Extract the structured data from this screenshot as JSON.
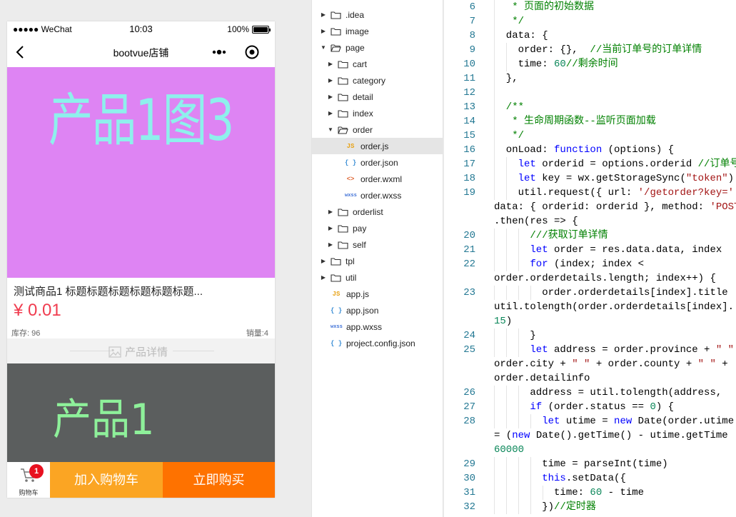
{
  "phone": {
    "status": {
      "carrier": "●●●●● WeChat",
      "time": "10:03",
      "battery": "100%",
      "battery_level": 1.0
    },
    "nav": {
      "title": "bootvue店铺"
    },
    "banner_text": "产品1图3",
    "product": {
      "title": "测试商品1 标题标题标题标题标题标题...",
      "price": "¥ 0.01",
      "stock": "库存: 96",
      "sales": "销量:4"
    },
    "detail_label": "产品详情",
    "detail_image_text": "产品1",
    "tabbar": {
      "cart_label": "购物车",
      "cart_badge": "1",
      "add_cart": "加入购物车",
      "buy_now": "立即购买"
    },
    "colors": {
      "banner": "#de84f3",
      "banner_text": "#8ef0ec",
      "detail_bg": "#5b5e5e",
      "detail_text": "#8ef09a",
      "price": "#f03c4f",
      "add_cart": "#fba523",
      "buy_now": "#fe7200",
      "badge": "#e8101f"
    }
  },
  "tree": [
    {
      "label": ".idea",
      "kind": "folder",
      "depth": 0,
      "open": false
    },
    {
      "label": "image",
      "kind": "folder",
      "depth": 0,
      "open": false
    },
    {
      "label": "page",
      "kind": "folder",
      "depth": 0,
      "open": true
    },
    {
      "label": "cart",
      "kind": "folder",
      "depth": 1,
      "open": false
    },
    {
      "label": "category",
      "kind": "folder",
      "depth": 1,
      "open": false
    },
    {
      "label": "detail",
      "kind": "folder",
      "depth": 1,
      "open": false
    },
    {
      "label": "index",
      "kind": "folder",
      "depth": 1,
      "open": false
    },
    {
      "label": "order",
      "kind": "folder",
      "depth": 1,
      "open": true
    },
    {
      "label": "order.js",
      "kind": "js",
      "depth": 2,
      "selected": true
    },
    {
      "label": "order.json",
      "kind": "json",
      "depth": 2
    },
    {
      "label": "order.wxml",
      "kind": "wxml",
      "depth": 2
    },
    {
      "label": "order.wxss",
      "kind": "wxss",
      "depth": 2
    },
    {
      "label": "orderlist",
      "kind": "folder",
      "depth": 1,
      "open": false
    },
    {
      "label": "pay",
      "kind": "folder",
      "depth": 1,
      "open": false
    },
    {
      "label": "self",
      "kind": "folder",
      "depth": 1,
      "open": false
    },
    {
      "label": "tpl",
      "kind": "folder",
      "depth": 0,
      "open": false
    },
    {
      "label": "util",
      "kind": "folder",
      "depth": 0,
      "open": false
    },
    {
      "label": "app.js",
      "kind": "js",
      "depth": 0
    },
    {
      "label": "app.json",
      "kind": "json",
      "depth": 0
    },
    {
      "label": "app.wxss",
      "kind": "wxss",
      "depth": 0
    },
    {
      "label": "project.config.json",
      "kind": "json",
      "depth": 0
    }
  ],
  "file_icons": {
    "js": "JS",
    "json": "{ }",
    "wxml": "<>",
    "wxss": "wxss"
  },
  "editor": {
    "lines": [
      {
        "no": "6",
        "indent": 1,
        "tokens": [
          [
            "c",
            "   * 页面的初始数据"
          ]
        ]
      },
      {
        "no": "7",
        "indent": 1,
        "tokens": [
          [
            "c",
            "   */"
          ]
        ]
      },
      {
        "no": "8",
        "indent": 1,
        "tokens": [
          [
            "p",
            "  data: {"
          ]
        ]
      },
      {
        "no": "9",
        "indent": 2,
        "tokens": [
          [
            "p",
            "    order: {},  "
          ],
          [
            "c",
            "//当前订单号的订单详情"
          ]
        ]
      },
      {
        "no": "10",
        "indent": 2,
        "tokens": [
          [
            "p",
            "    time: "
          ],
          [
            "n",
            "60"
          ],
          [
            "c",
            "//剩余时间"
          ]
        ]
      },
      {
        "no": "11",
        "indent": 1,
        "tokens": [
          [
            "p",
            "  },"
          ]
        ]
      },
      {
        "no": "12",
        "indent": 1,
        "tokens": [
          [
            "p",
            ""
          ]
        ]
      },
      {
        "no": "13",
        "indent": 1,
        "tokens": [
          [
            "c",
            "  /**"
          ]
        ]
      },
      {
        "no": "14",
        "indent": 1,
        "tokens": [
          [
            "c",
            "   * 生命周期函数--监听页面加载"
          ]
        ]
      },
      {
        "no": "15",
        "indent": 1,
        "tokens": [
          [
            "c",
            "   */"
          ]
        ]
      },
      {
        "no": "16",
        "indent": 1,
        "tokens": [
          [
            "p",
            "  onLoad: "
          ],
          [
            "k",
            "function"
          ],
          [
            "p",
            " (options) {"
          ]
        ]
      },
      {
        "no": "17",
        "indent": 2,
        "tokens": [
          [
            "k",
            "    let"
          ],
          [
            "p",
            " orderid = options.orderid "
          ],
          [
            "c",
            "//订单号"
          ]
        ]
      },
      {
        "no": "18",
        "indent": 2,
        "tokens": [
          [
            "k",
            "    let"
          ],
          [
            "p",
            " key = wx.getStorageSync("
          ],
          [
            "s",
            "\"token\""
          ],
          [
            "p",
            ")"
          ]
        ]
      },
      {
        "no": "19",
        "indent": 2,
        "tokens": [
          [
            "p",
            "    util.request({ url: "
          ],
          [
            "s",
            "'/getorder?key='"
          ]
        ]
      },
      {
        "no": "",
        "indent": 0,
        "tokens": [
          [
            "p",
            "data: { orderid: orderid }, method: "
          ],
          [
            "s",
            "'POST'"
          ]
        ]
      },
      {
        "no": "",
        "indent": 0,
        "tokens": [
          [
            "p",
            ".then(res => {"
          ]
        ]
      },
      {
        "no": "20",
        "indent": 3,
        "tokens": [
          [
            "c",
            "      ///获取订单详情"
          ]
        ]
      },
      {
        "no": "21",
        "indent": 3,
        "tokens": [
          [
            "k",
            "      let"
          ],
          [
            "p",
            " order = res.data.data, index"
          ]
        ]
      },
      {
        "no": "22",
        "indent": 3,
        "tokens": [
          [
            "k",
            "      for"
          ],
          [
            "p",
            " (index; index <"
          ]
        ]
      },
      {
        "no": "",
        "indent": 0,
        "tokens": [
          [
            "p",
            "order.orderdetails.length; index++) {"
          ]
        ]
      },
      {
        "no": "23",
        "indent": 4,
        "tokens": [
          [
            "p",
            "        order.orderdetails[index].title"
          ]
        ]
      },
      {
        "no": "",
        "indent": 0,
        "tokens": [
          [
            "p",
            "util.tolength(order.orderdetails[index]."
          ]
        ]
      },
      {
        "no": "",
        "indent": 0,
        "tokens": [
          [
            "n",
            "15"
          ],
          [
            "p",
            ")"
          ]
        ]
      },
      {
        "no": "24",
        "indent": 3,
        "tokens": [
          [
            "p",
            "      }"
          ]
        ]
      },
      {
        "no": "25",
        "indent": 3,
        "tokens": [
          [
            "k",
            "      let"
          ],
          [
            "p",
            " address = order.province + "
          ],
          [
            "s",
            "\" \""
          ]
        ]
      },
      {
        "no": "",
        "indent": 0,
        "tokens": [
          [
            "p",
            "order.city + "
          ],
          [
            "s",
            "\" \""
          ],
          [
            "p",
            " + order.county + "
          ],
          [
            "s",
            "\" \""
          ],
          [
            "p",
            " +"
          ]
        ]
      },
      {
        "no": "",
        "indent": 0,
        "tokens": [
          [
            "p",
            "order.detailinfo"
          ]
        ]
      },
      {
        "no": "26",
        "indent": 3,
        "tokens": [
          [
            "p",
            "      address = util.tolength(address,"
          ]
        ]
      },
      {
        "no": "27",
        "indent": 3,
        "tokens": [
          [
            "k",
            "      if"
          ],
          [
            "p",
            " (order.status == "
          ],
          [
            "n",
            "0"
          ],
          [
            "p",
            ") {"
          ]
        ]
      },
      {
        "no": "28",
        "indent": 4,
        "tokens": [
          [
            "k",
            "        let"
          ],
          [
            "p",
            " utime = "
          ],
          [
            "k",
            "new"
          ],
          [
            "p",
            " Date(order.utime"
          ]
        ]
      },
      {
        "no": "",
        "indent": 0,
        "tokens": [
          [
            "p",
            "= ("
          ],
          [
            "k",
            "new"
          ],
          [
            "p",
            " Date().getTime() - utime.getTime"
          ]
        ]
      },
      {
        "no": "",
        "indent": 0,
        "tokens": [
          [
            "n",
            "60000"
          ]
        ]
      },
      {
        "no": "29",
        "indent": 4,
        "tokens": [
          [
            "p",
            "        time = parseInt(time)"
          ]
        ]
      },
      {
        "no": "30",
        "indent": 4,
        "tokens": [
          [
            "k",
            "        this"
          ],
          [
            "p",
            ".setData({"
          ]
        ]
      },
      {
        "no": "31",
        "indent": 5,
        "tokens": [
          [
            "p",
            "          time: "
          ],
          [
            "n",
            "60"
          ],
          [
            "p",
            " - time"
          ]
        ]
      },
      {
        "no": "32",
        "indent": 4,
        "tokens": [
          [
            "p",
            "        })"
          ],
          [
            "c",
            "//定时器"
          ]
        ]
      }
    ]
  }
}
